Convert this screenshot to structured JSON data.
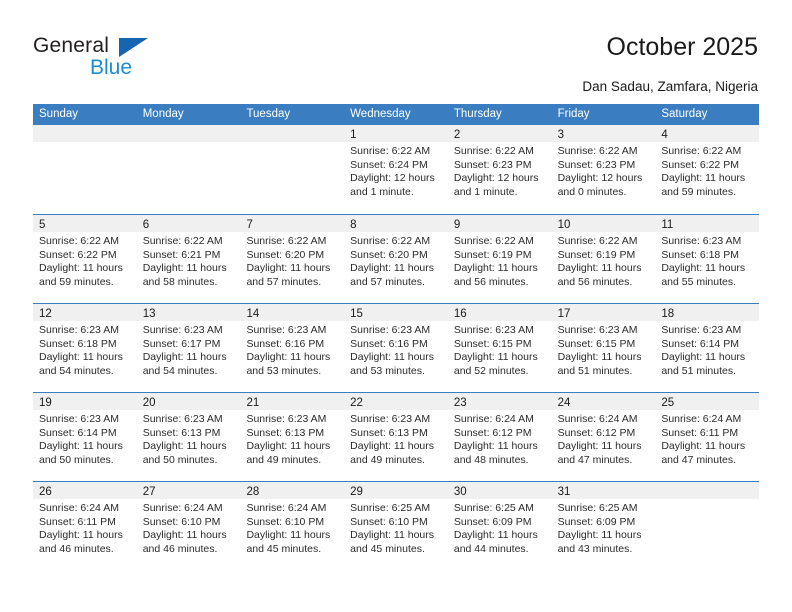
{
  "logo": {
    "word_top": "General",
    "word_bottom": "Blue",
    "triangle_icon": "triangle-icon",
    "color_dark": "#231f20",
    "color_blue": "#1e8bd6",
    "color_triangle": "#1565b0"
  },
  "header": {
    "title": "October 2025",
    "subtitle": "Dan Sadau, Zamfara, Nigeria"
  },
  "colors": {
    "header_bar": "#3a7dc0",
    "daynum_band": "#f0f0f0",
    "text": "#1a1a1a"
  },
  "calendar": {
    "weekdays": [
      "Sunday",
      "Monday",
      "Tuesday",
      "Wednesday",
      "Thursday",
      "Friday",
      "Saturday"
    ],
    "weeks": [
      [
        {
          "empty": true
        },
        {
          "empty": true
        },
        {
          "empty": true
        },
        {
          "day": "1",
          "sunrise": "Sunrise: 6:22 AM",
          "sunset": "Sunset: 6:24 PM",
          "daylight_1": "Daylight: 12 hours",
          "daylight_2": "and 1 minute."
        },
        {
          "day": "2",
          "sunrise": "Sunrise: 6:22 AM",
          "sunset": "Sunset: 6:23 PM",
          "daylight_1": "Daylight: 12 hours",
          "daylight_2": "and 1 minute."
        },
        {
          "day": "3",
          "sunrise": "Sunrise: 6:22 AM",
          "sunset": "Sunset: 6:23 PM",
          "daylight_1": "Daylight: 12 hours",
          "daylight_2": "and 0 minutes."
        },
        {
          "day": "4",
          "sunrise": "Sunrise: 6:22 AM",
          "sunset": "Sunset: 6:22 PM",
          "daylight_1": "Daylight: 11 hours",
          "daylight_2": "and 59 minutes."
        }
      ],
      [
        {
          "day": "5",
          "sunrise": "Sunrise: 6:22 AM",
          "sunset": "Sunset: 6:22 PM",
          "daylight_1": "Daylight: 11 hours",
          "daylight_2": "and 59 minutes."
        },
        {
          "day": "6",
          "sunrise": "Sunrise: 6:22 AM",
          "sunset": "Sunset: 6:21 PM",
          "daylight_1": "Daylight: 11 hours",
          "daylight_2": "and 58 minutes."
        },
        {
          "day": "7",
          "sunrise": "Sunrise: 6:22 AM",
          "sunset": "Sunset: 6:20 PM",
          "daylight_1": "Daylight: 11 hours",
          "daylight_2": "and 57 minutes."
        },
        {
          "day": "8",
          "sunrise": "Sunrise: 6:22 AM",
          "sunset": "Sunset: 6:20 PM",
          "daylight_1": "Daylight: 11 hours",
          "daylight_2": "and 57 minutes."
        },
        {
          "day": "9",
          "sunrise": "Sunrise: 6:22 AM",
          "sunset": "Sunset: 6:19 PM",
          "daylight_1": "Daylight: 11 hours",
          "daylight_2": "and 56 minutes."
        },
        {
          "day": "10",
          "sunrise": "Sunrise: 6:22 AM",
          "sunset": "Sunset: 6:19 PM",
          "daylight_1": "Daylight: 11 hours",
          "daylight_2": "and 56 minutes."
        },
        {
          "day": "11",
          "sunrise": "Sunrise: 6:23 AM",
          "sunset": "Sunset: 6:18 PM",
          "daylight_1": "Daylight: 11 hours",
          "daylight_2": "and 55 minutes."
        }
      ],
      [
        {
          "day": "12",
          "sunrise": "Sunrise: 6:23 AM",
          "sunset": "Sunset: 6:18 PM",
          "daylight_1": "Daylight: 11 hours",
          "daylight_2": "and 54 minutes."
        },
        {
          "day": "13",
          "sunrise": "Sunrise: 6:23 AM",
          "sunset": "Sunset: 6:17 PM",
          "daylight_1": "Daylight: 11 hours",
          "daylight_2": "and 54 minutes."
        },
        {
          "day": "14",
          "sunrise": "Sunrise: 6:23 AM",
          "sunset": "Sunset: 6:16 PM",
          "daylight_1": "Daylight: 11 hours",
          "daylight_2": "and 53 minutes."
        },
        {
          "day": "15",
          "sunrise": "Sunrise: 6:23 AM",
          "sunset": "Sunset: 6:16 PM",
          "daylight_1": "Daylight: 11 hours",
          "daylight_2": "and 53 minutes."
        },
        {
          "day": "16",
          "sunrise": "Sunrise: 6:23 AM",
          "sunset": "Sunset: 6:15 PM",
          "daylight_1": "Daylight: 11 hours",
          "daylight_2": "and 52 minutes."
        },
        {
          "day": "17",
          "sunrise": "Sunrise: 6:23 AM",
          "sunset": "Sunset: 6:15 PM",
          "daylight_1": "Daylight: 11 hours",
          "daylight_2": "and 51 minutes."
        },
        {
          "day": "18",
          "sunrise": "Sunrise: 6:23 AM",
          "sunset": "Sunset: 6:14 PM",
          "daylight_1": "Daylight: 11 hours",
          "daylight_2": "and 51 minutes."
        }
      ],
      [
        {
          "day": "19",
          "sunrise": "Sunrise: 6:23 AM",
          "sunset": "Sunset: 6:14 PM",
          "daylight_1": "Daylight: 11 hours",
          "daylight_2": "and 50 minutes."
        },
        {
          "day": "20",
          "sunrise": "Sunrise: 6:23 AM",
          "sunset": "Sunset: 6:13 PM",
          "daylight_1": "Daylight: 11 hours",
          "daylight_2": "and 50 minutes."
        },
        {
          "day": "21",
          "sunrise": "Sunrise: 6:23 AM",
          "sunset": "Sunset: 6:13 PM",
          "daylight_1": "Daylight: 11 hours",
          "daylight_2": "and 49 minutes."
        },
        {
          "day": "22",
          "sunrise": "Sunrise: 6:23 AM",
          "sunset": "Sunset: 6:13 PM",
          "daylight_1": "Daylight: 11 hours",
          "daylight_2": "and 49 minutes."
        },
        {
          "day": "23",
          "sunrise": "Sunrise: 6:24 AM",
          "sunset": "Sunset: 6:12 PM",
          "daylight_1": "Daylight: 11 hours",
          "daylight_2": "and 48 minutes."
        },
        {
          "day": "24",
          "sunrise": "Sunrise: 6:24 AM",
          "sunset": "Sunset: 6:12 PM",
          "daylight_1": "Daylight: 11 hours",
          "daylight_2": "and 47 minutes."
        },
        {
          "day": "25",
          "sunrise": "Sunrise: 6:24 AM",
          "sunset": "Sunset: 6:11 PM",
          "daylight_1": "Daylight: 11 hours",
          "daylight_2": "and 47 minutes."
        }
      ],
      [
        {
          "day": "26",
          "sunrise": "Sunrise: 6:24 AM",
          "sunset": "Sunset: 6:11 PM",
          "daylight_1": "Daylight: 11 hours",
          "daylight_2": "and 46 minutes."
        },
        {
          "day": "27",
          "sunrise": "Sunrise: 6:24 AM",
          "sunset": "Sunset: 6:10 PM",
          "daylight_1": "Daylight: 11 hours",
          "daylight_2": "and 46 minutes."
        },
        {
          "day": "28",
          "sunrise": "Sunrise: 6:24 AM",
          "sunset": "Sunset: 6:10 PM",
          "daylight_1": "Daylight: 11 hours",
          "daylight_2": "and 45 minutes."
        },
        {
          "day": "29",
          "sunrise": "Sunrise: 6:25 AM",
          "sunset": "Sunset: 6:10 PM",
          "daylight_1": "Daylight: 11 hours",
          "daylight_2": "and 45 minutes."
        },
        {
          "day": "30",
          "sunrise": "Sunrise: 6:25 AM",
          "sunset": "Sunset: 6:09 PM",
          "daylight_1": "Daylight: 11 hours",
          "daylight_2": "and 44 minutes."
        },
        {
          "day": "31",
          "sunrise": "Sunrise: 6:25 AM",
          "sunset": "Sunset: 6:09 PM",
          "daylight_1": "Daylight: 11 hours",
          "daylight_2": "and 43 minutes."
        },
        {
          "empty": true
        }
      ]
    ]
  }
}
